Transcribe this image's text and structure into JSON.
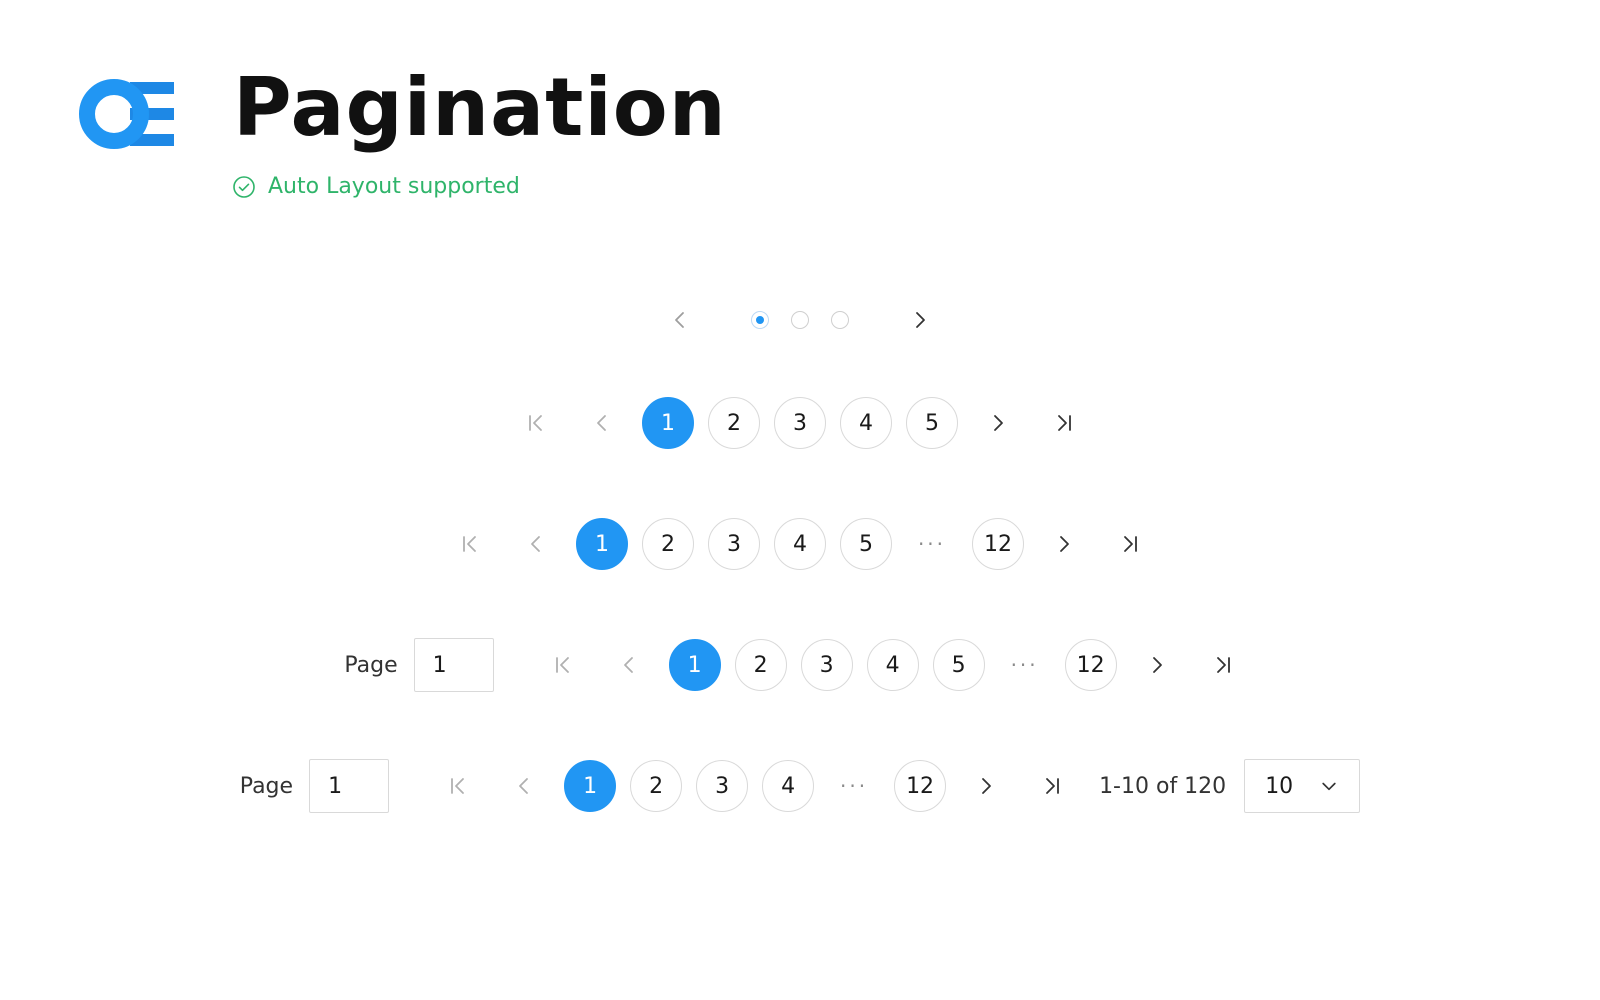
{
  "header": {
    "title": "Pagination",
    "subtitle": "Auto Layout supported",
    "brand_color": "#2196f3",
    "subtitle_color": "#2fb46a",
    "logo": "oe-logo",
    "subtitle_icon": "check-circle-icon"
  },
  "colors": {
    "active": "#2196f3",
    "border": "#d9d9d9",
    "icon": "#9e9e9e"
  },
  "dots": {
    "count": 3,
    "active_index": 0
  },
  "row2": {
    "pages": [
      "1",
      "2",
      "3",
      "4",
      "5"
    ],
    "active": "1"
  },
  "row3": {
    "pages": [
      "1",
      "2",
      "3",
      "4",
      "5"
    ],
    "ellipsis": "···",
    "last": "12",
    "active": "1"
  },
  "row4": {
    "page_label": "Page",
    "page_value": "1",
    "pages": [
      "1",
      "2",
      "3",
      "4",
      "5"
    ],
    "ellipsis": "···",
    "last": "12",
    "active": "1"
  },
  "row5": {
    "page_label": "Page",
    "page_value": "1",
    "pages": [
      "1",
      "2",
      "3",
      "4"
    ],
    "ellipsis": "···",
    "last": "12",
    "active": "1",
    "range_text": "1-10 of 120",
    "page_size": "10"
  }
}
